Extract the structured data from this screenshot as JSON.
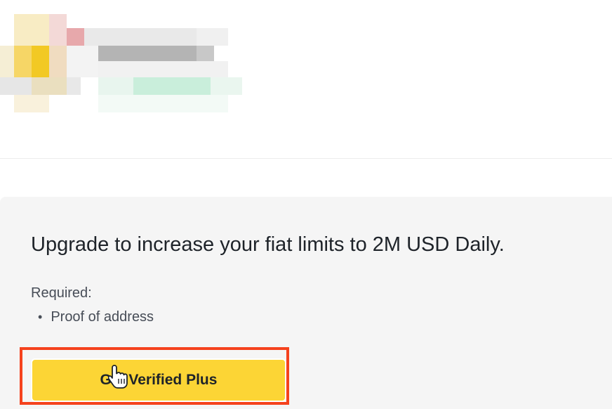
{
  "profile": {
    "redacted": true
  },
  "upgrade": {
    "title": "Upgrade to increase your fiat limits to 2M USD Daily.",
    "required_label": "Required:",
    "requirements": [
      "Proof of address"
    ],
    "button_label": "Get Verified Plus",
    "button_color": "#fcd535",
    "highlight_color": "#f5421d"
  },
  "icons": {
    "cursor": "hand-pointer-icon"
  }
}
